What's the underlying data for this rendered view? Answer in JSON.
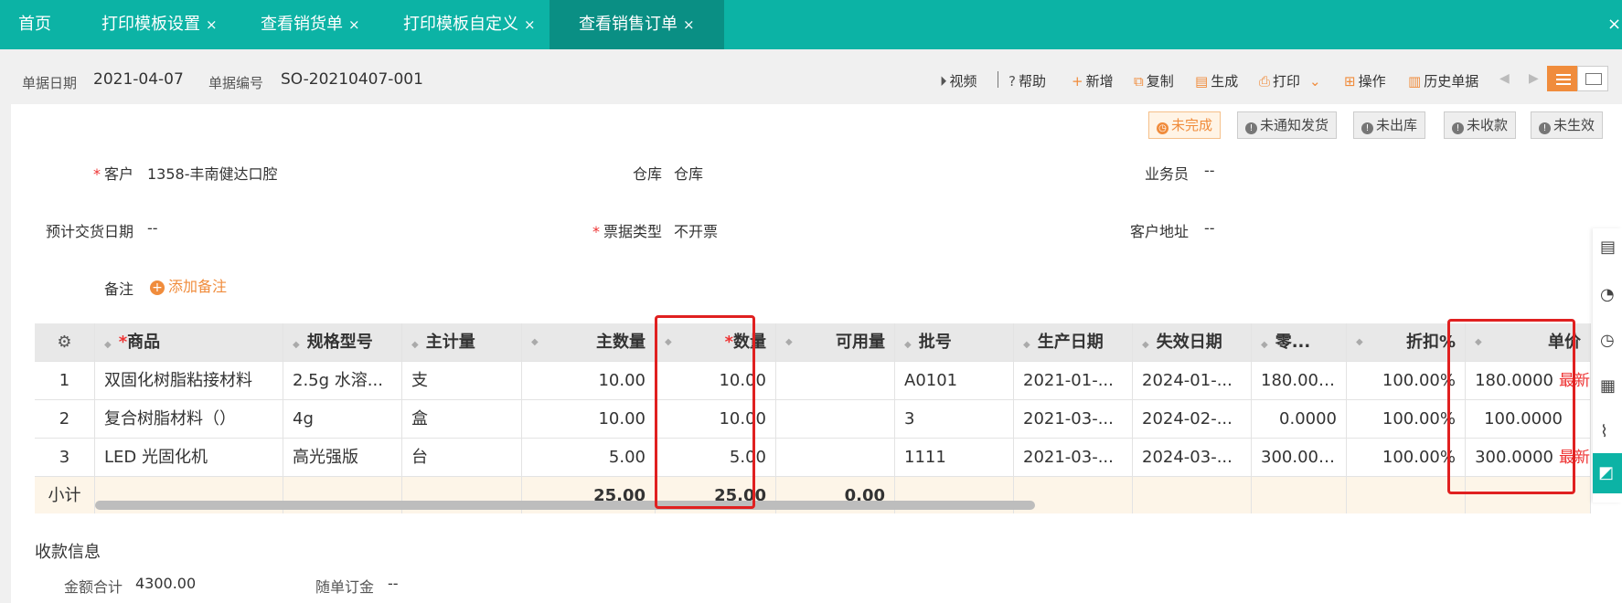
{
  "tabs": [
    {
      "label": "首页",
      "closable": false
    },
    {
      "label": "打印模板设置",
      "closable": true
    },
    {
      "label": "查看销货单",
      "closable": true
    },
    {
      "label": "打印模板自定义",
      "closable": true
    },
    {
      "label": "查看销售订单",
      "closable": true,
      "active": true
    }
  ],
  "close_glyph": "×",
  "header": {
    "date_label": "单据日期",
    "date_value": "2021-04-07",
    "no_label": "单据编号",
    "no_value": "SO-20210407-001"
  },
  "toolbar": {
    "video": "视频",
    "help": "帮助",
    "add": "新增",
    "copy": "复制",
    "generate": "生成",
    "print": "打印",
    "operate": "操作",
    "history": "历史单据"
  },
  "statuses": [
    "未完成",
    "未通知发货",
    "未出库",
    "未收款",
    "未生效"
  ],
  "form": {
    "customer_label": "客户",
    "customer_value": "1358-丰南健达口腔",
    "warehouse_label": "仓库",
    "warehouse_value": "仓库",
    "salesman_label": "业务员",
    "salesman_value": "--",
    "delivery_label": "预计交货日期",
    "delivery_value": "--",
    "invoice_label": "票据类型",
    "invoice_value": "不开票",
    "address_label": "客户地址",
    "address_value": "--",
    "remark_label": "备注",
    "add_remark": "添加备注"
  },
  "table": {
    "headers": [
      "商品",
      "规格型号",
      "主计量",
      "主数量",
      "数量",
      "可用量",
      "批号",
      "生产日期",
      "失效日期",
      "零...",
      "折扣%",
      "单价"
    ],
    "rows": [
      {
        "no": "1",
        "product": "双固化树脂粘接材料",
        "spec": "2.5g 水溶...",
        "unit": "支",
        "main_qty": "10.00",
        "qty": "10.00",
        "avail": "",
        "batch": "A0101",
        "mfg": "2021-01-...",
        "exp": "2024-01-...",
        "retail": "180.0000",
        "discount": "100.00%",
        "price": "180.0000",
        "latest": "最新"
      },
      {
        "no": "2",
        "product": "复合树脂材料（）",
        "spec": "4g",
        "unit": "盒",
        "main_qty": "10.00",
        "qty": "10.00",
        "avail": "",
        "batch": "3",
        "mfg": "2021-03-...",
        "exp": "2024-02-...",
        "retail": "0.0000",
        "discount": "100.00%",
        "price": "100.0000",
        "latest": ""
      },
      {
        "no": "3",
        "product": "LED 光固化机",
        "spec": "高光强版",
        "unit": "台",
        "main_qty": "5.00",
        "qty": "5.00",
        "avail": "",
        "batch": "1111",
        "mfg": "2021-03-...",
        "exp": "2024-03-...",
        "retail": "300.0000",
        "discount": "100.00%",
        "price": "300.0000",
        "latest": "最新"
      }
    ],
    "subtotal_label": "小计",
    "subtotal_main_qty": "25.00",
    "subtotal_qty": "25.00",
    "subtotal_avail": "0.00"
  },
  "payment": {
    "title": "收款信息",
    "total_label": "金额合计",
    "total_value": "4300.00",
    "deposit_label": "随单订金",
    "deposit_value": "--"
  }
}
